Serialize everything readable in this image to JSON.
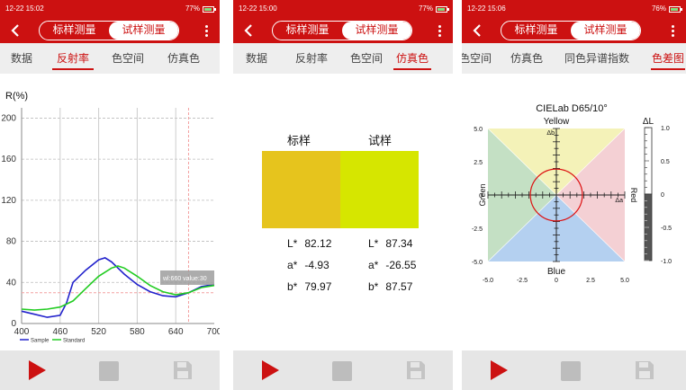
{
  "accent_color": "#cc1111",
  "screens": [
    {
      "status": {
        "time": "12-22 15:02",
        "battery": "77%",
        "battery_level": 0.77
      },
      "segment": {
        "left": "标样测量",
        "right": "试样测量",
        "selected": "right"
      },
      "tabs": [
        "数据",
        "反射率",
        "色空间",
        "仿真色"
      ],
      "active_tab": 1
    },
    {
      "status": {
        "time": "12-22 15:00",
        "battery": "77%",
        "battery_level": 0.77
      },
      "segment": {
        "left": "标样测量",
        "right": "试样测量",
        "selected": "right"
      },
      "tabs": [
        "数据",
        "反射率",
        "色空间",
        "仿真色"
      ],
      "active_tab": 3
    },
    {
      "status": {
        "time": "12-22 15:06",
        "battery": "76%",
        "battery_level": 0.76
      },
      "segment": {
        "left": "标样测量",
        "right": "试样测量",
        "selected": "right"
      },
      "tabs": [
        "色空间",
        "仿真色",
        "同色异谱指数",
        "色差图"
      ],
      "active_tab": 3
    }
  ],
  "reflectance": {
    "ylabel": "R(%)",
    "x_ticks": [
      "400",
      "460",
      "520",
      "580",
      "640",
      "700"
    ],
    "y_ticks": [
      "0",
      "40",
      "80",
      "120",
      "160",
      "200"
    ],
    "legend": [
      "Sample",
      "Standard"
    ],
    "tooltip": "wl:660 value:30"
  },
  "simulated": {
    "standard": {
      "title": "标样",
      "color": "#e6c41d",
      "L": "82.12",
      "a": "-4.93",
      "b": "79.97"
    },
    "trial": {
      "title": "试样",
      "color": "#d6e600",
      "L": "87.34",
      "a": "-26.55",
      "b": "87.57"
    },
    "labels": {
      "L": "L*",
      "a": "a*",
      "b": "b*"
    }
  },
  "diff_chart": {
    "title": "CIELab D65/10°",
    "yellow": "Yellow",
    "blue": "Blue",
    "green": "Green",
    "red": "Red",
    "db": "Δb",
    "da": "Δa",
    "dl": "ΔL",
    "ab_ticks": [
      "5.0",
      "2.5",
      "0",
      "-2.5",
      "-5.0"
    ],
    "x_ticks": [
      "-5.0",
      "-2.5",
      "0",
      "2.5",
      "5.0"
    ],
    "dl_ticks": [
      "1.0",
      "0.5",
      "0",
      "-0.5",
      "-1.0"
    ]
  },
  "chart_data": [
    {
      "type": "line",
      "title": "",
      "xlabel": "",
      "ylabel": "R(%)",
      "xlim": [
        400,
        700
      ],
      "ylim": [
        0,
        210
      ],
      "grid": true,
      "legend_position": "bottom-left",
      "series": [
        {
          "name": "Sample",
          "color": "#2222cc",
          "x": [
            400,
            420,
            440,
            460,
            470,
            480,
            500,
            520,
            530,
            540,
            560,
            580,
            600,
            620,
            640,
            660,
            680,
            700
          ],
          "y": [
            12,
            9,
            6,
            8,
            20,
            40,
            52,
            62,
            64,
            60,
            48,
            38,
            31,
            27,
            26,
            30,
            36,
            38
          ]
        },
        {
          "name": "Standard",
          "color": "#22cc22",
          "x": [
            400,
            420,
            440,
            460,
            480,
            500,
            520,
            540,
            550,
            560,
            580,
            600,
            620,
            640,
            660,
            680,
            700
          ],
          "y": [
            14,
            13,
            14,
            16,
            22,
            34,
            46,
            54,
            56,
            54,
            46,
            37,
            31,
            28,
            30,
            35,
            37
          ]
        }
      ]
    },
    {
      "type": "scatter",
      "title": "CIELab D65/10°",
      "xlabel": "Δa",
      "ylabel": "Δb",
      "xlim": [
        -5,
        5
      ],
      "ylim": [
        -5,
        5
      ],
      "circle_radius": 1.9
    }
  ]
}
